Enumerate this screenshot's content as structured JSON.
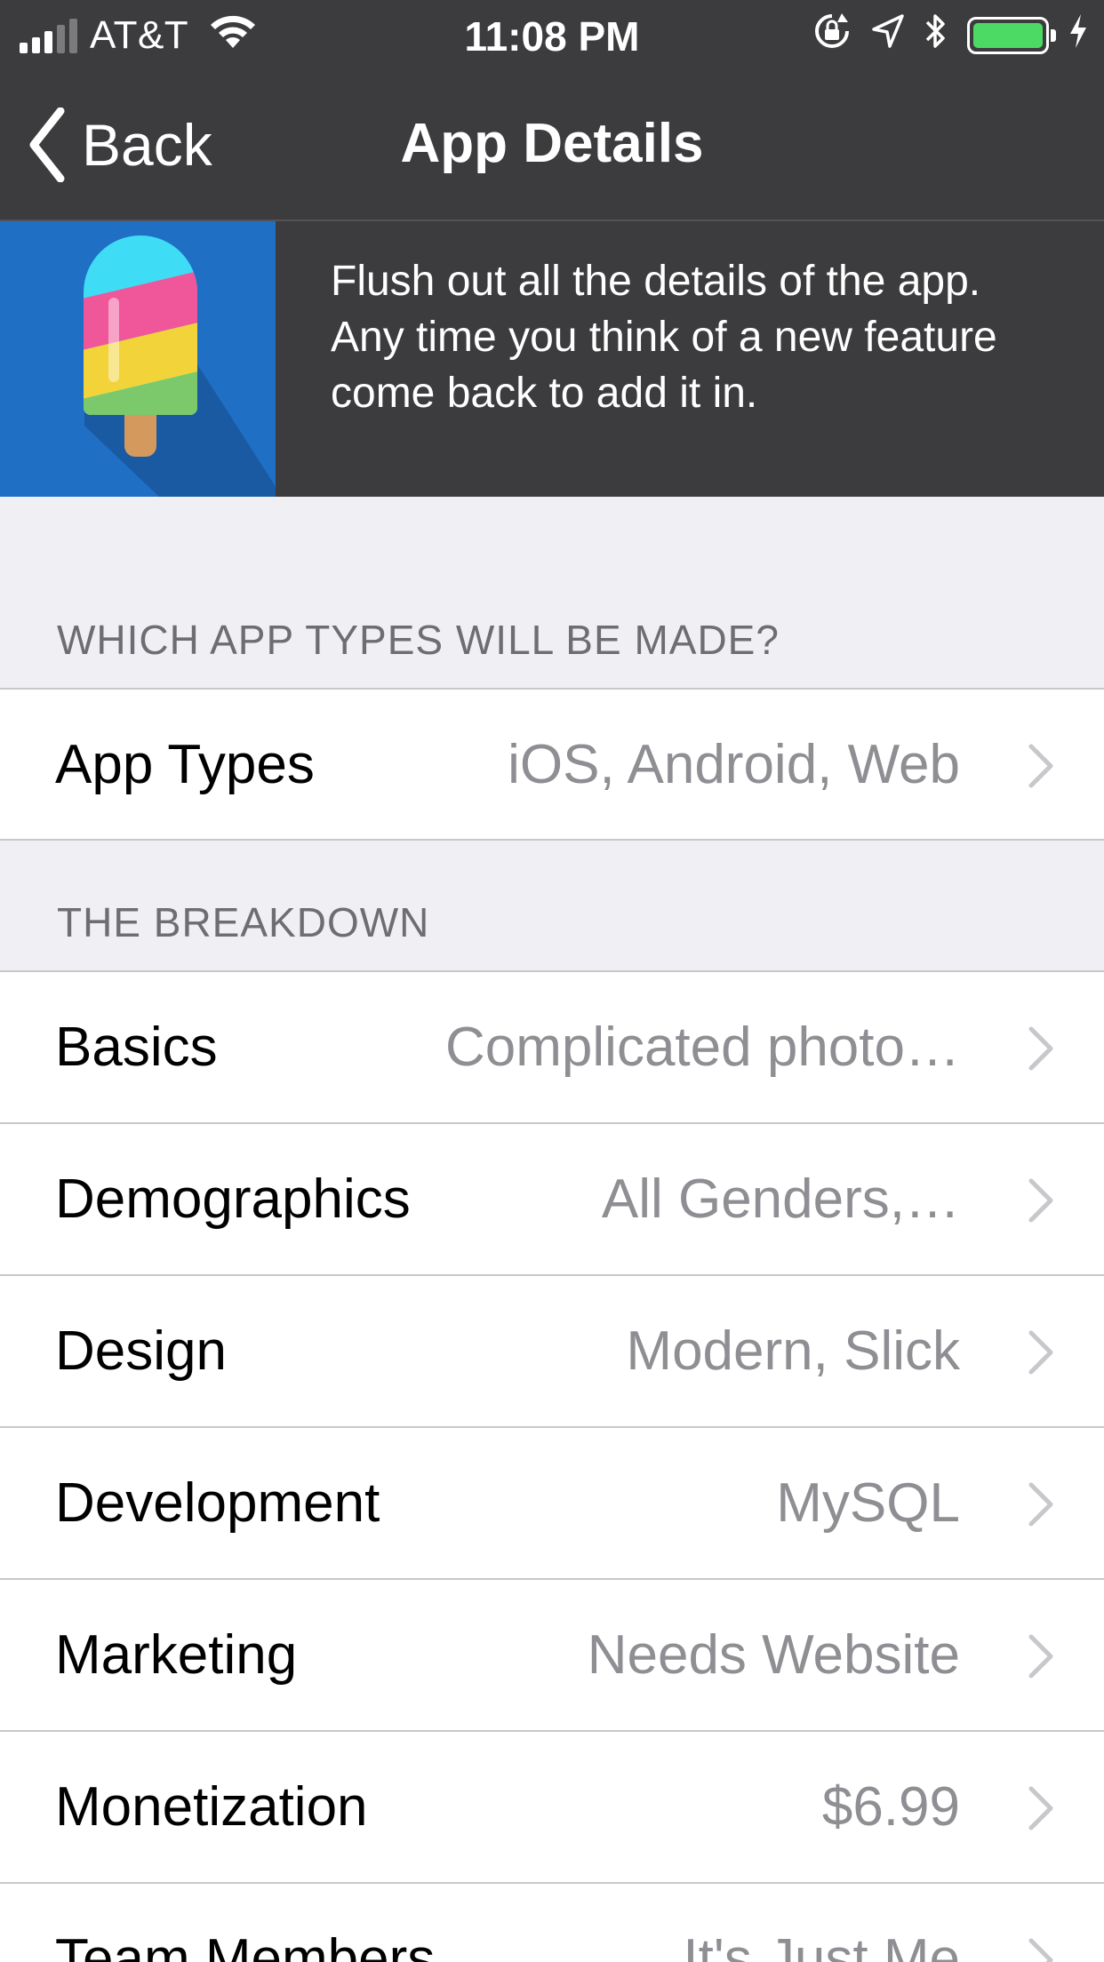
{
  "status_bar": {
    "carrier": "AT&T",
    "time": "11:08 PM",
    "battery_level": 1.0,
    "battery_color": "#4cd964",
    "icons": [
      "signal-icon",
      "wifi-icon",
      "orientation-lock-icon",
      "location-arrow-icon",
      "bluetooth-icon",
      "battery-icon",
      "charging-bolt-icon"
    ]
  },
  "nav": {
    "back_label": "Back",
    "title": "App Details"
  },
  "hero": {
    "description": "Flush out all the details of the app. Any time you think of a new feature come back to add it in.",
    "icon": "popsicle-icon",
    "colors": {
      "banner_bg": "#3c3c3e",
      "art_bg": "#1f6fc5"
    }
  },
  "sections": [
    {
      "header": "WHICH APP TYPES WILL BE MADE?",
      "rows": [
        {
          "label": "App Types",
          "value": "iOS, Android, Web"
        }
      ]
    },
    {
      "header": "THE BREAKDOWN",
      "rows": [
        {
          "label": "Basics",
          "value": "Complicated photo…"
        },
        {
          "label": "Demographics",
          "value": "All Genders,…"
        },
        {
          "label": "Design",
          "value": "Modern, Slick"
        },
        {
          "label": "Development",
          "value": "MySQL"
        },
        {
          "label": "Marketing",
          "value": "Needs Website"
        },
        {
          "label": "Monetization",
          "value": "$6.99"
        },
        {
          "label": "Team Members",
          "value": "It's Just Me"
        }
      ]
    }
  ]
}
